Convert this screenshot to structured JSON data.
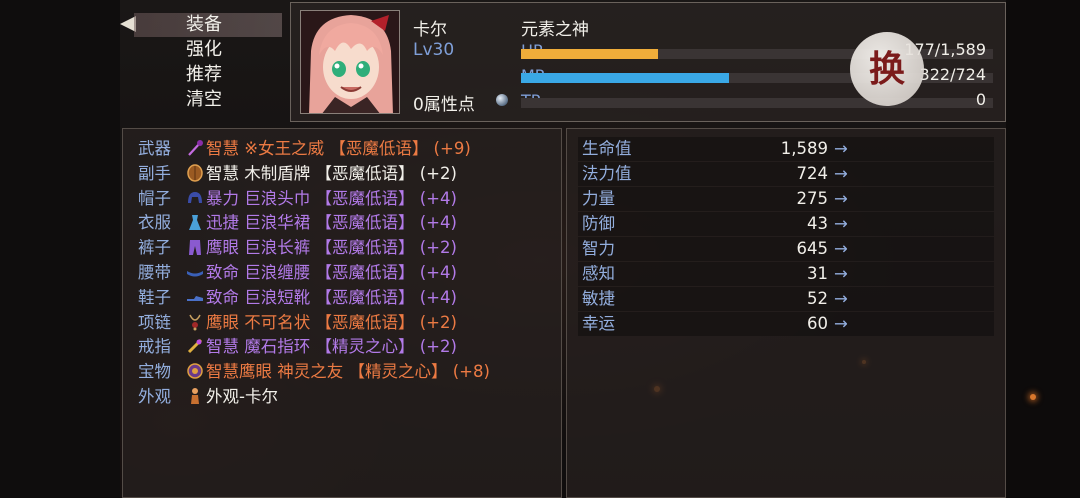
{
  "menu": {
    "items": [
      "装备",
      "强化",
      "推荐",
      "清空"
    ],
    "selected_index": 0
  },
  "character": {
    "name": "卡尔",
    "title": "元素之神",
    "level": "Lv30",
    "attribute_points": "0属性点",
    "hp": {
      "label": "HP",
      "value": "177/1,589",
      "fraction": 0.29,
      "color": "#f0ad3a"
    },
    "mp": {
      "label": "MP",
      "value": "322/724",
      "fraction": 0.44,
      "color": "#3aa8e6"
    },
    "tp": {
      "label": "TP",
      "value": "0",
      "fraction": 0
    }
  },
  "swap_button": {
    "label": "换"
  },
  "equipment": [
    {
      "slot": "武器",
      "icon": "staff-icon",
      "text": "智慧 ※女王之威 【恶魔低语】 (+9)",
      "color": "orange"
    },
    {
      "slot": "副手",
      "icon": "shield-icon",
      "text": "智慧 木制盾牌 【恶魔低语】 (+2)",
      "color": "white"
    },
    {
      "slot": "帽子",
      "icon": "helmet-icon",
      "text": "暴力 巨浪头巾 【恶魔低语】 (+4)",
      "color": "purple"
    },
    {
      "slot": "衣服",
      "icon": "dress-icon",
      "text": "迅捷 巨浪华裙 【恶魔低语】 (+4)",
      "color": "purple"
    },
    {
      "slot": "裤子",
      "icon": "pants-icon",
      "text": "鹰眼 巨浪长裤 【恶魔低语】 (+2)",
      "color": "purple"
    },
    {
      "slot": "腰带",
      "icon": "belt-icon",
      "text": "致命 巨浪缠腰 【恶魔低语】 (+4)",
      "color": "purple"
    },
    {
      "slot": "鞋子",
      "icon": "shoes-icon",
      "text": "致命 巨浪短靴 【恶魔低语】 (+4)",
      "color": "purple"
    },
    {
      "slot": "项链",
      "icon": "necklace-icon",
      "text": "鹰眼 不可名状 【恶魔低语】 (+2)",
      "color": "orange"
    },
    {
      "slot": "戒指",
      "icon": "ring-icon",
      "text": "智慧 魔石指环 【精灵之心】 (+2)",
      "color": "purple"
    },
    {
      "slot": "宝物",
      "icon": "treasure-icon",
      "text": "智慧鹰眼 神灵之友 【精灵之心】 (+8)",
      "color": "orange"
    },
    {
      "slot": "外观",
      "icon": "appearance-icon",
      "text": "外观-卡尔",
      "color": "white"
    }
  ],
  "stats": [
    {
      "name": "生命值",
      "value": "1,589",
      "arrow": "→"
    },
    {
      "name": "法力值",
      "value": "724",
      "arrow": "→"
    },
    {
      "name": "力量",
      "value": "275",
      "arrow": "→"
    },
    {
      "name": "防御",
      "value": "43",
      "arrow": "→"
    },
    {
      "name": "智力",
      "value": "645",
      "arrow": "→"
    },
    {
      "name": "感知",
      "value": "31",
      "arrow": "→"
    },
    {
      "name": "敏捷",
      "value": "52",
      "arrow": "→"
    },
    {
      "name": "幸运",
      "value": "60",
      "arrow": "→"
    }
  ]
}
